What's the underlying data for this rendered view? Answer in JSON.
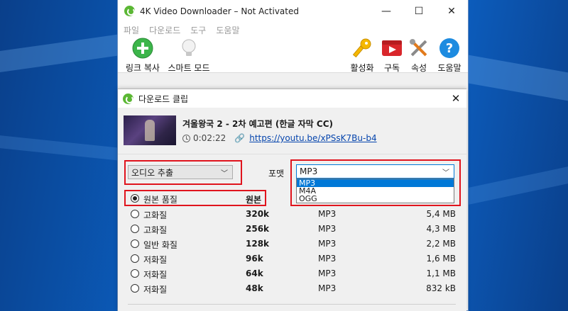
{
  "window": {
    "title": "4K Video Downloader – Not Activated",
    "min": "—",
    "max": "☐",
    "close": "✕"
  },
  "menu": [
    "파일",
    "다운로드",
    "도구",
    "도움말"
  ],
  "toolbar": {
    "paste_link": "링크 복사",
    "smart_mode": "스마트 모드",
    "activate": "활성화",
    "subscribe": "구독",
    "preferences": "속성",
    "help": "도움말"
  },
  "dialog": {
    "title": "다운로드 클립",
    "close": "✕",
    "video_title": "겨울왕국 2 - 2차 예고편 (한글 자막 CC)",
    "duration": "0:02:22",
    "url": "https://youtu.be/xPSsK7Bu-b4",
    "mode_select": "오디오 추출",
    "format_label": "포맷",
    "format_select": "MP3",
    "format_options": [
      "MP3",
      "M4A",
      "OGG"
    ],
    "qualities": [
      {
        "name": "원본 품질",
        "bitrate": "원본",
        "format": "",
        "size": "",
        "selected": true
      },
      {
        "name": "고화질",
        "bitrate": "320k",
        "format": "MP3",
        "size": "5,4 MB",
        "selected": false
      },
      {
        "name": "고화질",
        "bitrate": "256k",
        "format": "MP3",
        "size": "4,3 MB",
        "selected": false
      },
      {
        "name": "일반 화질",
        "bitrate": "128k",
        "format": "MP3",
        "size": "2,2 MB",
        "selected": false
      },
      {
        "name": "저화질",
        "bitrate": "96k",
        "format": "MP3",
        "size": "1,6 MB",
        "selected": false
      },
      {
        "name": "저화질",
        "bitrate": "64k",
        "format": "MP3",
        "size": "1,1 MB",
        "selected": false
      },
      {
        "name": "저화질",
        "bitrate": "48k",
        "format": "MP3",
        "size": "832 kB",
        "selected": false
      }
    ]
  },
  "colors": {
    "accent": "#0078d7",
    "highlight": "#e0141d",
    "app_green": "#5bb734"
  }
}
